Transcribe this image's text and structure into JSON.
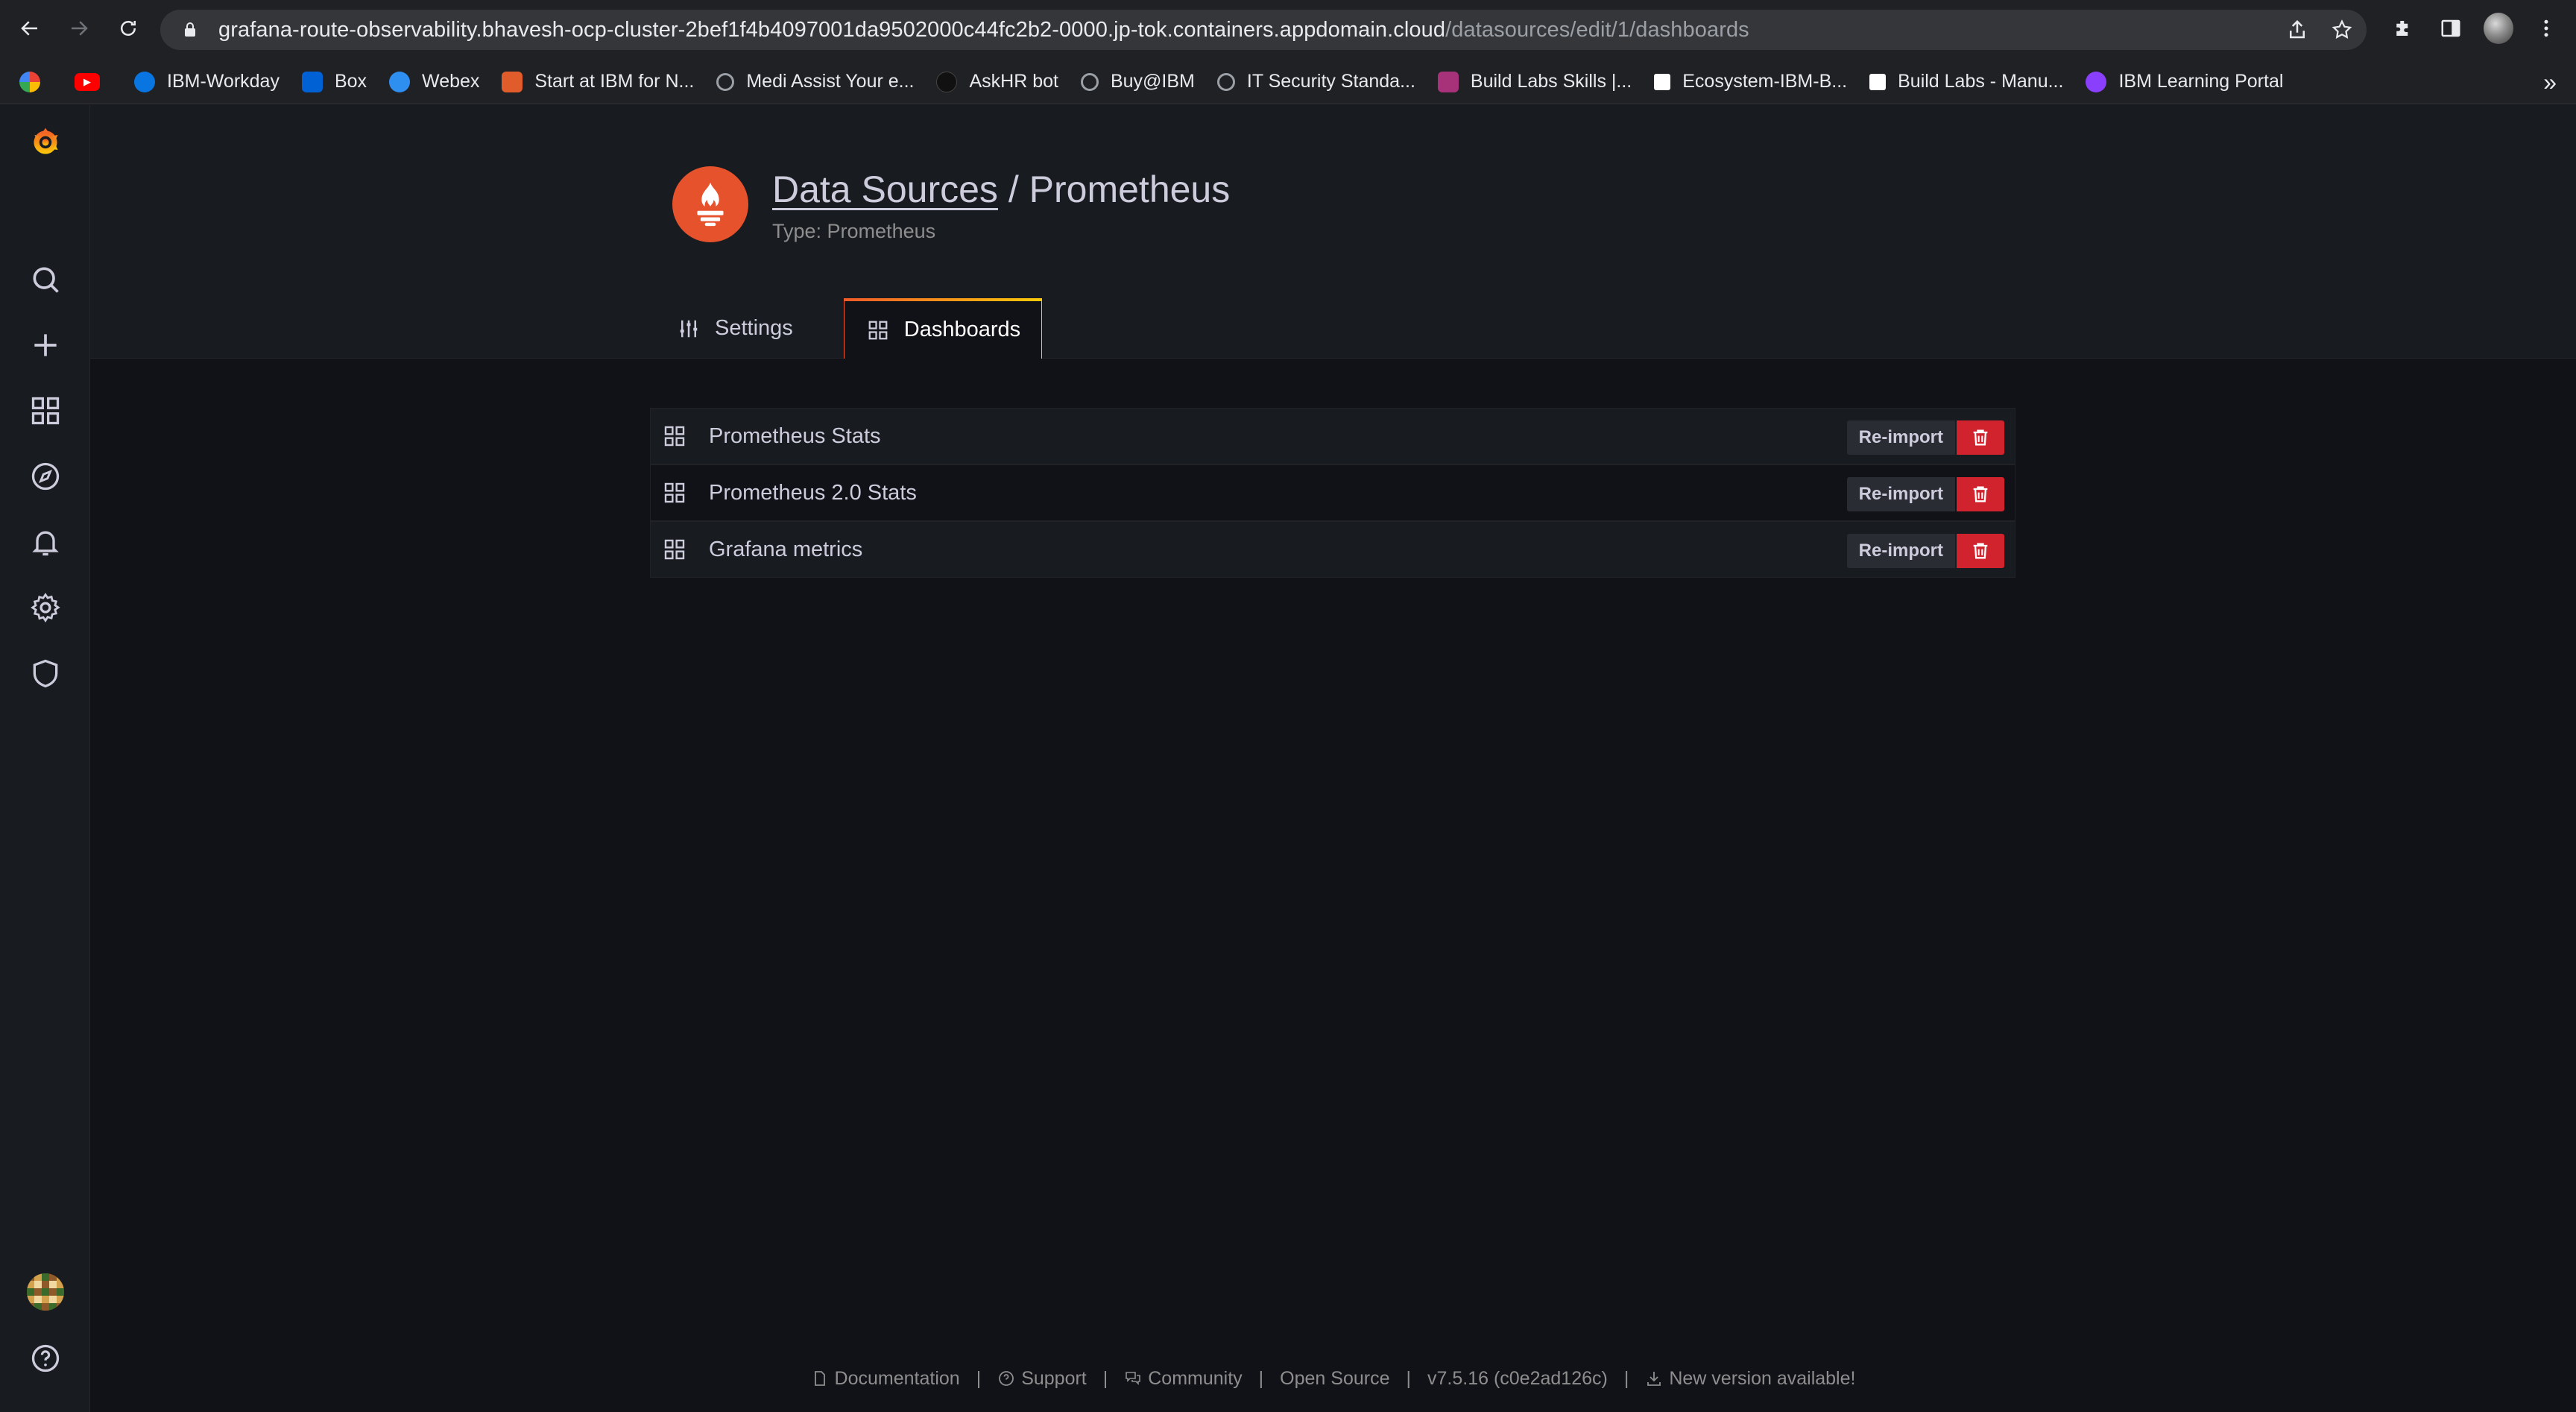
{
  "browser": {
    "url_host": "grafana-route-observability.bhavesh-ocp-cluster-2bef1f4b4097001da9502000c44fc2b2-0000.jp-tok.containers.appdomain.cloud",
    "url_path": "/datasources/edit/1/dashboards",
    "bookmarks": [
      {
        "label": "",
        "icon": "google-icon",
        "color": "#ffffff"
      },
      {
        "label": "",
        "icon": "youtube-icon",
        "color": "#ff0000"
      },
      {
        "label": "IBM-Workday",
        "icon": "workday-icon",
        "color": "#0875e1"
      },
      {
        "label": "Box",
        "icon": "box-icon",
        "color": "#0061d5"
      },
      {
        "label": "Webex",
        "icon": "webex-icon",
        "color": "#2f8ff0"
      },
      {
        "label": "Start at IBM for N...",
        "icon": "start-icon",
        "color": "#e05c2a"
      },
      {
        "label": "Medi Assist Your e...",
        "icon": "globe-icon",
        "color": "#9aa0a6"
      },
      {
        "label": "AskHR bot",
        "icon": "dot-icon",
        "color": "#111111"
      },
      {
        "label": "Buy@IBM",
        "icon": "cart-icon",
        "color": "#9aa0a6"
      },
      {
        "label": "IT Security Standa...",
        "icon": "globe-icon",
        "color": "#9aa0a6"
      },
      {
        "label": "Build Labs Skills |...",
        "icon": "buildlabs-icon",
        "color": "#a83279"
      },
      {
        "label": "Ecosystem-IBM-B...",
        "icon": "trello-icon",
        "color": "#ffffff"
      },
      {
        "label": "Build Labs - Manu...",
        "icon": "notion-icon",
        "color": "#ffffff"
      },
      {
        "label": "IBM Learning Portal",
        "icon": "learning-icon",
        "color": "#8a3ffc"
      }
    ],
    "bookmarks_more": "»"
  },
  "header": {
    "breadcrumb_link": "Data Sources",
    "separator": "/",
    "title": "Prometheus",
    "subtitle": "Type: Prometheus",
    "logo_color": "#e6522c"
  },
  "tabs": [
    {
      "label": "Settings",
      "active": false
    },
    {
      "label": "Dashboards",
      "active": true
    }
  ],
  "dashboards": [
    {
      "name": "Prometheus Stats",
      "action": "Re-import"
    },
    {
      "name": "Prometheus 2.0 Stats",
      "action": "Re-import"
    },
    {
      "name": "Grafana metrics",
      "action": "Re-import"
    }
  ],
  "footer": {
    "documentation": "Documentation",
    "support": "Support",
    "community": "Community",
    "open_source": "Open Source",
    "version": "v7.5.16 (c0e2ad126c)",
    "new_version": "New version available!",
    "sep": "|"
  },
  "colors": {
    "accent": "#f05a28",
    "danger": "#d1232d",
    "background": "#111217",
    "panel": "#181b1f"
  }
}
